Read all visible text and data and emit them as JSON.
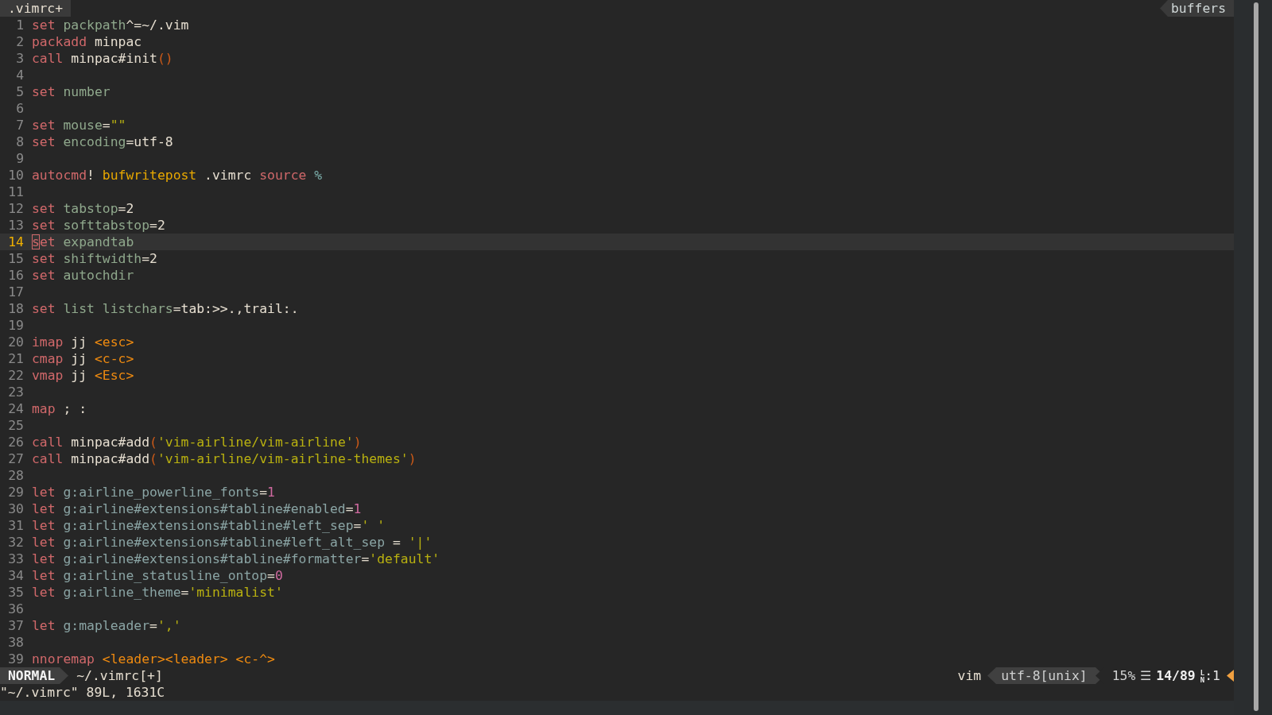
{
  "tabline": {
    "tabs": [
      {
        "label": ".vimrc+",
        "selected": true
      }
    ],
    "buffers_label": "buffers"
  },
  "lines": [
    {
      "n": "1",
      "current": false,
      "tokens": [
        {
          "t": "set",
          "kind": "kw"
        },
        {
          "t": " packpath",
          "kind": "opt"
        },
        {
          "t": "^=~/.vim",
          "kind": "plain"
        }
      ]
    },
    {
      "n": "2",
      "current": false,
      "tokens": [
        {
          "t": "packadd",
          "kind": "kw"
        },
        {
          "t": " minpac",
          "kind": "plain"
        }
      ]
    },
    {
      "n": "3",
      "current": false,
      "tokens": [
        {
          "t": "call",
          "kind": "kw"
        },
        {
          "t": " minpac#init",
          "kind": "plain"
        },
        {
          "t": "()",
          "kind": "paren"
        }
      ]
    },
    {
      "n": "4",
      "current": false
    },
    {
      "n": "5",
      "current": false,
      "tokens": [
        {
          "t": "set",
          "kind": "kw"
        },
        {
          "t": " number",
          "kind": "opt"
        }
      ]
    },
    {
      "n": "6",
      "current": false
    },
    {
      "n": "7",
      "current": false,
      "tokens": [
        {
          "t": "set",
          "kind": "kw"
        },
        {
          "t": " mouse",
          "kind": "opt"
        },
        {
          "t": "=",
          "kind": "plain"
        },
        {
          "t": "\"\"",
          "kind": "str"
        }
      ]
    },
    {
      "n": "8",
      "current": false,
      "tokens": [
        {
          "t": "set",
          "kind": "kw"
        },
        {
          "t": " encoding",
          "kind": "opt"
        },
        {
          "t": "=utf-8",
          "kind": "plain"
        }
      ]
    },
    {
      "n": "9",
      "current": false
    },
    {
      "n": "10",
      "current": false,
      "tokens": [
        {
          "t": "autocmd",
          "kind": "kw"
        },
        {
          "t": "!",
          "kind": "plain"
        },
        {
          "t": " bufwritepost",
          "kind": "event"
        },
        {
          "t": " .vimrc",
          "kind": "plain"
        },
        {
          "t": " source",
          "kind": "kw"
        },
        {
          "t": " %",
          "kind": "special2"
        }
      ]
    },
    {
      "n": "11",
      "current": false
    },
    {
      "n": "12",
      "current": false,
      "tokens": [
        {
          "t": "set",
          "kind": "kw"
        },
        {
          "t": " tabstop",
          "kind": "opt"
        },
        {
          "t": "=2",
          "kind": "plain"
        }
      ]
    },
    {
      "n": "13",
      "current": false,
      "tokens": [
        {
          "t": "set",
          "kind": "kw"
        },
        {
          "t": " softtabstop",
          "kind": "opt"
        },
        {
          "t": "=2",
          "kind": "plain"
        }
      ]
    },
    {
      "n": "14",
      "current": true,
      "tokens": [
        {
          "t": "s",
          "kind": "kw",
          "cursor": true
        },
        {
          "t": "et",
          "kind": "kw"
        },
        {
          "t": " expandtab",
          "kind": "opt"
        }
      ]
    },
    {
      "n": "15",
      "current": false,
      "tokens": [
        {
          "t": "set",
          "kind": "kw"
        },
        {
          "t": " shiftwidth",
          "kind": "opt"
        },
        {
          "t": "=2",
          "kind": "plain"
        }
      ]
    },
    {
      "n": "16",
      "current": false,
      "tokens": [
        {
          "t": "set",
          "kind": "kw"
        },
        {
          "t": " autochdir",
          "kind": "opt"
        }
      ]
    },
    {
      "n": "17",
      "current": false
    },
    {
      "n": "18",
      "current": false,
      "tokens": [
        {
          "t": "set",
          "kind": "kw"
        },
        {
          "t": " list listchars",
          "kind": "opt"
        },
        {
          "t": "=tab:>>.,trail:.",
          "kind": "plain"
        }
      ]
    },
    {
      "n": "19",
      "current": false
    },
    {
      "n": "20",
      "current": false,
      "tokens": [
        {
          "t": "imap",
          "kind": "kw"
        },
        {
          "t": " jj ",
          "kind": "plain"
        },
        {
          "t": "<esc>",
          "kind": "spec"
        }
      ]
    },
    {
      "n": "21",
      "current": false,
      "tokens": [
        {
          "t": "cmap",
          "kind": "kw"
        },
        {
          "t": " jj ",
          "kind": "plain"
        },
        {
          "t": "<c-c>",
          "kind": "spec"
        }
      ]
    },
    {
      "n": "22",
      "current": false,
      "tokens": [
        {
          "t": "vmap",
          "kind": "kw"
        },
        {
          "t": " jj ",
          "kind": "plain"
        },
        {
          "t": "<Esc>",
          "kind": "spec"
        }
      ]
    },
    {
      "n": "23",
      "current": false
    },
    {
      "n": "24",
      "current": false,
      "tokens": [
        {
          "t": "map",
          "kind": "kw"
        },
        {
          "t": " ; :",
          "kind": "plain"
        }
      ]
    },
    {
      "n": "25",
      "current": false
    },
    {
      "n": "26",
      "current": false,
      "tokens": [
        {
          "t": "call",
          "kind": "kw"
        },
        {
          "t": " minpac#add",
          "kind": "plain"
        },
        {
          "t": "(",
          "kind": "paren"
        },
        {
          "t": "'vim-airline/vim-airline'",
          "kind": "str"
        },
        {
          "t": ")",
          "kind": "paren"
        }
      ]
    },
    {
      "n": "27",
      "current": false,
      "tokens": [
        {
          "t": "call",
          "kind": "kw"
        },
        {
          "t": " minpac#add",
          "kind": "plain"
        },
        {
          "t": "(",
          "kind": "paren"
        },
        {
          "t": "'vim-airline/vim-airline-themes'",
          "kind": "str"
        },
        {
          "t": ")",
          "kind": "paren"
        }
      ]
    },
    {
      "n": "28",
      "current": false
    },
    {
      "n": "29",
      "current": false,
      "tokens": [
        {
          "t": "let",
          "kind": "kw"
        },
        {
          "t": " g:airline_powerline_fonts",
          "kind": "var"
        },
        {
          "t": "=",
          "kind": "plain"
        },
        {
          "t": "1",
          "kind": "num"
        }
      ]
    },
    {
      "n": "30",
      "current": false,
      "tokens": [
        {
          "t": "let",
          "kind": "kw"
        },
        {
          "t": " g:airline#extensions#tabline#enabled",
          "kind": "var"
        },
        {
          "t": "=",
          "kind": "plain"
        },
        {
          "t": "1",
          "kind": "num"
        }
      ]
    },
    {
      "n": "31",
      "current": false,
      "tokens": [
        {
          "t": "let",
          "kind": "kw"
        },
        {
          "t": " g:airline#extensions#tabline#left_sep",
          "kind": "var"
        },
        {
          "t": "=",
          "kind": "plain"
        },
        {
          "t": "' '",
          "kind": "str"
        }
      ]
    },
    {
      "n": "32",
      "current": false,
      "tokens": [
        {
          "t": "let",
          "kind": "kw"
        },
        {
          "t": " g:airline#extensions#tabline#left_alt_sep",
          "kind": "var"
        },
        {
          "t": " = ",
          "kind": "plain"
        },
        {
          "t": "'|'",
          "kind": "str"
        }
      ]
    },
    {
      "n": "33",
      "current": false,
      "tokens": [
        {
          "t": "let",
          "kind": "kw"
        },
        {
          "t": " g:airline#extensions#tabline#formatter",
          "kind": "var"
        },
        {
          "t": "=",
          "kind": "plain"
        },
        {
          "t": "'default'",
          "kind": "str"
        }
      ]
    },
    {
      "n": "34",
      "current": false,
      "tokens": [
        {
          "t": "let",
          "kind": "kw"
        },
        {
          "t": " g:airline_statusline_ontop",
          "kind": "var"
        },
        {
          "t": "=",
          "kind": "plain"
        },
        {
          "t": "0",
          "kind": "num"
        }
      ]
    },
    {
      "n": "35",
      "current": false,
      "tokens": [
        {
          "t": "let",
          "kind": "kw"
        },
        {
          "t": " g:airline_theme",
          "kind": "var"
        },
        {
          "t": "=",
          "kind": "plain"
        },
        {
          "t": "'minimalist'",
          "kind": "str"
        }
      ]
    },
    {
      "n": "36",
      "current": false
    },
    {
      "n": "37",
      "current": false,
      "tokens": [
        {
          "t": "let",
          "kind": "kw"
        },
        {
          "t": " g:mapleader",
          "kind": "var"
        },
        {
          "t": "=",
          "kind": "plain"
        },
        {
          "t": "','",
          "kind": "str"
        }
      ]
    },
    {
      "n": "38",
      "current": false
    },
    {
      "n": "39",
      "current": false,
      "tokens": [
        {
          "t": "nnoremap",
          "kind": "kw"
        },
        {
          "t": " <leader><leader>",
          "kind": "spec"
        },
        {
          "t": " <c-^>",
          "kind": "spec"
        }
      ]
    }
  ],
  "status_bar": {
    "mode": "NORMAL",
    "file": "~/.vimrc[+]",
    "filetype": "vim",
    "encoding": "utf-8[unix]",
    "percent": "15%",
    "lines_glyph": "☰",
    "position": "14/89",
    "ln_glyph": "LN",
    "column": ":1"
  },
  "command_line": "\"~/.vimrc\" 89L, 1631C"
}
